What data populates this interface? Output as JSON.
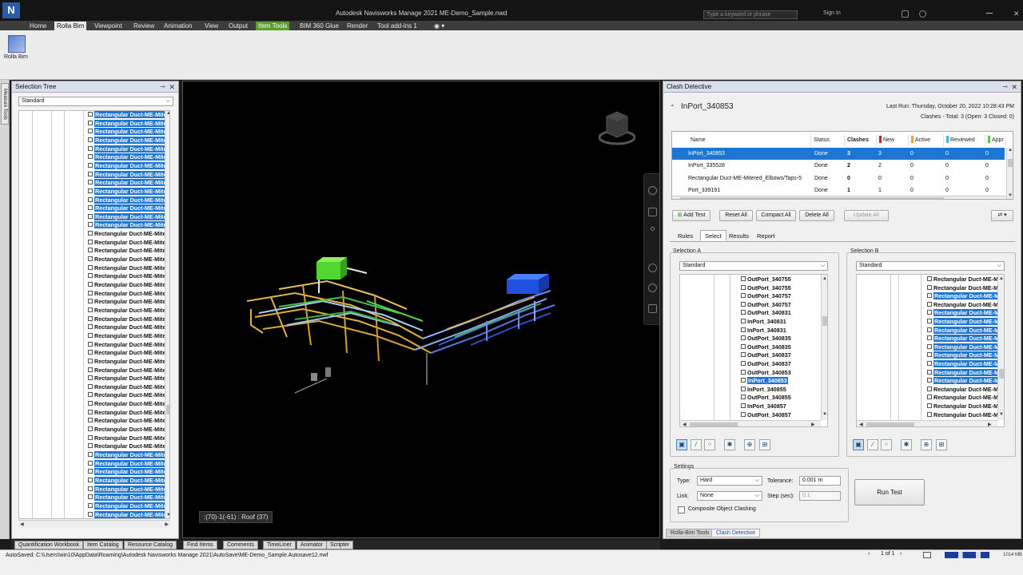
{
  "window": {
    "title": "Autodesk Navisworks Manage 2021   ME-Demo_Sample.nwd",
    "search_placeholder": "Type a keyword or phrase",
    "signin": "Sign In",
    "logo": "N"
  },
  "menu": [
    "Home",
    "Rolla Bim",
    "Viewpoint",
    "Review",
    "Animation",
    "View",
    "Output",
    "Item Tools",
    "BIM 360 Glue",
    "Render",
    "Tool add-ins 1"
  ],
  "ribbon": {
    "button_label": "Rolla Bim"
  },
  "left_strip": {
    "tab": "Measure Tools"
  },
  "selection_tree": {
    "title": "Selection Tree",
    "dropdown": "Standard",
    "rows": [
      {
        "label": "Rectangular Duct-ME-Mitered",
        "sel": true
      },
      {
        "label": "Rectangular Duct-ME-Mitered",
        "sel": true
      },
      {
        "label": "Rectangular Duct-ME-Mitered",
        "sel": true
      },
      {
        "label": "Rectangular Duct-ME-Mitered",
        "sel": true
      },
      {
        "label": "Rectangular Duct-ME-Mitered",
        "sel": true
      },
      {
        "label": "Rectangular Duct-ME-Mitered",
        "sel": true
      },
      {
        "label": "Rectangular Duct-ME-Mitered",
        "sel": true
      },
      {
        "label": "Rectangular Duct-ME-Mitered",
        "sel": true
      },
      {
        "label": "Rectangular Duct-ME-Mitered",
        "sel": true
      },
      {
        "label": "Rectangular Duct-ME-Mitered",
        "sel": true
      },
      {
        "label": "Rectangular Duct-ME-Mitered",
        "sel": true
      },
      {
        "label": "Rectangular Duct-ME-Mitered",
        "sel": true
      },
      {
        "label": "Rectangular Duct-ME-Mitered",
        "sel": true
      },
      {
        "label": "Rectangular Duct-ME-Mitered",
        "sel": true
      },
      {
        "label": "Rectangular Duct-ME-Mitered",
        "sel": false
      },
      {
        "label": "Rectangular Duct-ME-Mitered",
        "sel": false
      },
      {
        "label": "Rectangular Duct-ME-Mitered",
        "sel": false
      },
      {
        "label": "Rectangular Duct-ME-Mitered",
        "sel": false
      },
      {
        "label": "Rectangular Duct-ME-Mitered",
        "sel": false
      },
      {
        "label": "Rectangular Duct-ME-Mitered",
        "sel": false
      },
      {
        "label": "Rectangular Duct-ME-Mitered",
        "sel": false
      },
      {
        "label": "Rectangular Duct-ME-Mitered",
        "sel": false
      },
      {
        "label": "Rectangular Duct-ME-Mitered",
        "sel": false
      },
      {
        "label": "Rectangular Duct-ME-Mitered",
        "sel": false
      },
      {
        "label": "Rectangular Duct-ME-Mitered",
        "sel": false
      },
      {
        "label": "Rectangular Duct-ME-Mitered",
        "sel": false
      },
      {
        "label": "Rectangular Duct-ME-Mitered",
        "sel": false
      },
      {
        "label": "Rectangular Duct-ME-Mitered",
        "sel": false
      },
      {
        "label": "Rectangular Duct-ME-Mitered",
        "sel": false
      },
      {
        "label": "Rectangular Duct-ME-Mitered",
        "sel": false
      },
      {
        "label": "Rectangular Duct-ME-Mitered",
        "sel": false
      },
      {
        "label": "Rectangular Duct-ME-Mitered",
        "sel": false
      },
      {
        "label": "Rectangular Duct-ME-Mitered",
        "sel": false
      },
      {
        "label": "Rectangular Duct-ME-Mitered",
        "sel": false
      },
      {
        "label": "Rectangular Duct-ME-Mitered",
        "sel": false
      },
      {
        "label": "Rectangular Duct-ME-Mitered",
        "sel": false
      },
      {
        "label": "Rectangular Duct-ME-Mitered",
        "sel": false
      },
      {
        "label": "Rectangular Duct-ME-Mitered",
        "sel": false
      },
      {
        "label": "Rectangular Duct-ME-Mitered",
        "sel": false
      },
      {
        "label": "Rectangular Duct-ME-Mitered",
        "sel": false
      },
      {
        "label": "Rectangular Duct-ME-Mitered",
        "sel": true
      },
      {
        "label": "Rectangular Duct-ME-Mitered",
        "sel": true
      },
      {
        "label": "Rectangular Duct-ME-Mitered",
        "sel": true
      },
      {
        "label": "Rectangular Duct-ME-Mitered",
        "sel": true
      },
      {
        "label": "Rectangular Duct-ME-Mitered",
        "sel": true
      },
      {
        "label": "Rectangular Duct-ME-Mitered",
        "sel": true
      },
      {
        "label": "Rectangular Duct-ME-Mitered",
        "sel": true
      },
      {
        "label": "Rectangular Duct-ME-Mitered",
        "sel": true
      }
    ]
  },
  "viewport": {
    "status_label": ":(70)-1(-61) : Roof (37)"
  },
  "clash": {
    "title": "Clash Detective",
    "test_name": "InPort_340853",
    "last_run": "Last Run:  Thursday, October 20, 2022 10:28:43 PM",
    "summary": "Clashes - Total:  3  (Open:  3  Closed:  0)",
    "columns": {
      "name": "Name",
      "status": "Status",
      "clashes": "Clashes",
      "new": "New",
      "active": "Active",
      "reviewed": "Reviewed",
      "approved": "Appr"
    },
    "colors": {
      "new": "#cc2020",
      "active": "#f0a030",
      "reviewed": "#40b8e0",
      "approved": "#50c850"
    },
    "tests": [
      {
        "name": "InPort_340853",
        "status": "Done",
        "clashes": "3",
        "new": "3",
        "active": "0",
        "reviewed": "0",
        "approved": "0",
        "sel": true
      },
      {
        "name": "InPort_335528",
        "status": "Done",
        "clashes": "2",
        "new": "2",
        "active": "0",
        "reviewed": "0",
        "approved": "0",
        "sel": false
      },
      {
        "name": "Rectangular Duct-ME-Mitered_Elbows/Taps-5",
        "status": "Done",
        "clashes": "0",
        "new": "0",
        "active": "0",
        "reviewed": "0",
        "approved": "0",
        "sel": false
      },
      {
        "name": "Port_339191",
        "status": "Done",
        "clashes": "1",
        "new": "1",
        "active": "0",
        "reviewed": "0",
        "approved": "0",
        "sel": false
      }
    ],
    "buttons": {
      "add_test": "Add Test",
      "reset_all": "Reset All",
      "compact_all": "Compact All",
      "delete_all": "Delete All",
      "update_all": "Update All"
    },
    "tabs": [
      "Rules",
      "Select",
      "Results",
      "Report"
    ],
    "selection_a": {
      "label": "Selection A",
      "dropdown": "Standard",
      "rows": [
        {
          "label": "OutPort_340755",
          "sel": false
        },
        {
          "label": "OutPort_340755",
          "sel": false
        },
        {
          "label": "OutPort_340757",
          "sel": false
        },
        {
          "label": "OutPort_340757",
          "sel": false
        },
        {
          "label": "OutPort_340831",
          "sel": false
        },
        {
          "label": "InPort_340831",
          "sel": false
        },
        {
          "label": "InPort_340831",
          "sel": false
        },
        {
          "label": "OutPort_340835",
          "sel": false
        },
        {
          "label": "OutPort_340835",
          "sel": false
        },
        {
          "label": "OutPort_340837",
          "sel": false
        },
        {
          "label": "OutPort_340837",
          "sel": false
        },
        {
          "label": "OutPort_340853",
          "sel": false
        },
        {
          "label": "InPort_340853",
          "sel": true
        },
        {
          "label": "InPort_340855",
          "sel": false
        },
        {
          "label": "OutPort_340855",
          "sel": false
        },
        {
          "label": "InPort_340857",
          "sel": false
        },
        {
          "label": "OutPort_340857",
          "sel": false
        }
      ]
    },
    "selection_b": {
      "label": "Selection B",
      "dropdown": "Standard",
      "rows": [
        {
          "label": "Rectangular Duct-ME-Mitered",
          "sel": false
        },
        {
          "label": "Rectangular Duct-ME-Mitered",
          "sel": false
        },
        {
          "label": "Rectangular Duct-ME-Mitered",
          "sel": true
        },
        {
          "label": "Rectangular Duct-ME-Mitered",
          "sel": false
        },
        {
          "label": "Rectangular Duct-ME-Mitered",
          "sel": true
        },
        {
          "label": "Rectangular Duct-ME-Mitered",
          "sel": true
        },
        {
          "label": "Rectangular Duct-ME-Mitered",
          "sel": true
        },
        {
          "label": "Rectangular Duct-ME-Mitered",
          "sel": true
        },
        {
          "label": "Rectangular Duct-ME-Mitered",
          "sel": true
        },
        {
          "label": "Rectangular Duct-ME-Mitered",
          "sel": true
        },
        {
          "label": "Rectangular Duct-ME-Mitered",
          "sel": true
        },
        {
          "label": "Rectangular Duct-ME-Mitered",
          "sel": true
        },
        {
          "label": "Rectangular Duct-ME-Mitered",
          "sel": true
        },
        {
          "label": "Rectangular Duct-ME-Mitered",
          "sel": false
        },
        {
          "label": "Rectangular Duct-ME-Mitered",
          "sel": false
        },
        {
          "label": "Rectangular Duct-ME-Mitered",
          "sel": false
        },
        {
          "label": "Rectangular Duct-ME-Mitered",
          "sel": false
        }
      ]
    },
    "settings": {
      "label": "Settings",
      "type_label": "Type:",
      "type_value": "Hard",
      "tolerance_label": "Tolerance:",
      "tolerance_value": "0.001 m",
      "link_label": "Link:",
      "link_value": "None",
      "step_label": "Step (sec):",
      "step_value": "0.1",
      "composite_label": "Composite Object Clashing"
    },
    "run_test": "Run Test",
    "bottom_tabs": [
      "Rolla-Bim Tools",
      "Clash Detective"
    ]
  },
  "workspace_tabs": [
    "Quantification Workbook",
    "Item Catalog",
    "Resource Catalog",
    "Find Items",
    "Comments",
    "TimeLiner",
    "Animator",
    "Scripter"
  ],
  "status": {
    "autosave": "AutoSaved: C:\\Users\\win10\\AppData\\Roaming\\Autodesk Navisworks Manage 2021\\AutoSave\\ME-Demo_Sample.Autosave12.nwf",
    "page": "1 of 1",
    "memory": "1014 MB"
  }
}
